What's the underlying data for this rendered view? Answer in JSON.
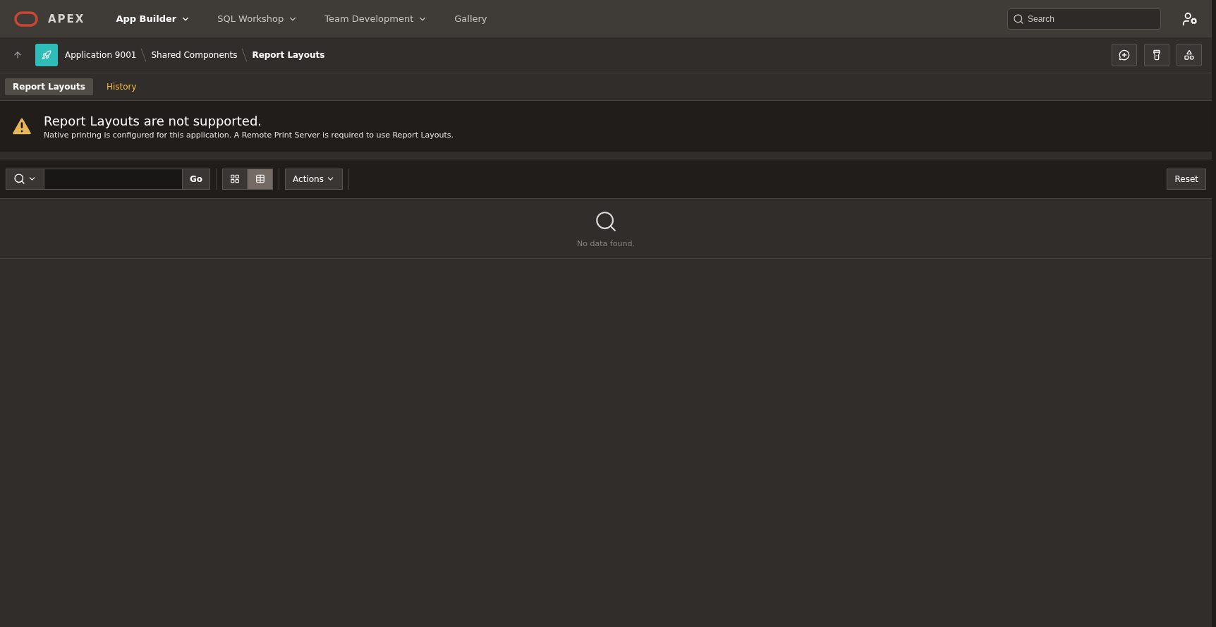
{
  "header": {
    "logo": "APEX",
    "nav": [
      {
        "label": "App Builder",
        "selected": true,
        "has_menu": true
      },
      {
        "label": "SQL Workshop",
        "selected": false,
        "has_menu": true
      },
      {
        "label": "Team Development",
        "selected": false,
        "has_menu": true
      },
      {
        "label": "Gallery",
        "selected": false,
        "has_menu": false
      }
    ],
    "search": {
      "placeholder": "Search"
    }
  },
  "breadcrumb": [
    "Application 9001",
    "Shared Components",
    "Report Layouts"
  ],
  "tabs": [
    {
      "label": "Report Layouts",
      "selected": true
    },
    {
      "label": "History",
      "selected": false
    }
  ],
  "alert": {
    "title": "Report Layouts are not supported.",
    "message": "Native printing is configured for this application. A Remote Print Server is required to use Report Layouts."
  },
  "toolbar": {
    "go": "Go",
    "views": [
      {
        "kind": "grid",
        "selected": false
      },
      {
        "kind": "table",
        "selected": true
      }
    ],
    "actions": "Actions",
    "reset": "Reset"
  },
  "empty": {
    "message": "No data found."
  }
}
